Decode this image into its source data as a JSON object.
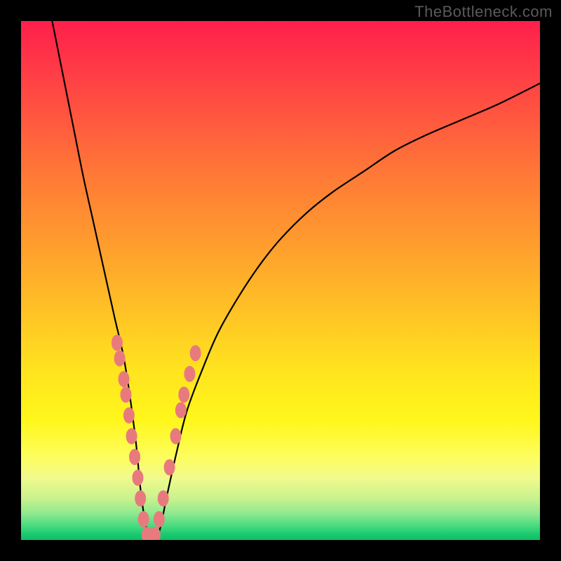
{
  "watermark": "TheBottleneck.com",
  "colors": {
    "frame": "#000000",
    "curve": "#000000",
    "dot": "#e87a7e",
    "gradient_top": "#ff1f4b",
    "gradient_bottom": "#0fbf67"
  },
  "chart_data": {
    "type": "line",
    "title": "",
    "xlabel": "",
    "ylabel": "",
    "x_range": [
      0,
      100
    ],
    "y_range": [
      0,
      100
    ],
    "description": "V-shaped bottleneck curve over red→green vertical gradient. Vertex near x≈24, y≈0. Left branch begins at top-left (x≈6, y≈100), drops steeply. Right branch rises with diminishing slope to roughly (x≈100, y≈88).",
    "series": [
      {
        "name": "bottleneck-curve",
        "x": [
          6,
          8,
          10,
          12,
          14,
          16,
          18,
          20,
          22,
          23,
          24,
          25,
          26,
          27,
          28,
          30,
          32,
          35,
          38,
          42,
          46,
          50,
          55,
          60,
          66,
          72,
          78,
          85,
          92,
          100
        ],
        "y": [
          100,
          90,
          80,
          70,
          61,
          52,
          43,
          34,
          20,
          10,
          3,
          0,
          0,
          3,
          8,
          17,
          25,
          33,
          40,
          47,
          53,
          58,
          63,
          67,
          71,
          75,
          78,
          81,
          84,
          88
        ]
      }
    ],
    "sample_points": {
      "name": "observed-dots",
      "note": "Pink dots clustered along the lower portion of both branches near the vertex.",
      "x": [
        18.5,
        19.0,
        19.8,
        20.2,
        20.8,
        21.3,
        21.9,
        22.5,
        23.0,
        23.6,
        24.3,
        25.0,
        25.8,
        26.6,
        27.4,
        28.6,
        29.8,
        30.8,
        31.4,
        32.5,
        33.6
      ],
      "y": [
        38,
        35,
        31,
        28,
        24,
        20,
        16,
        12,
        8,
        4,
        1,
        0,
        1,
        4,
        8,
        14,
        20,
        25,
        28,
        32,
        36
      ]
    }
  }
}
